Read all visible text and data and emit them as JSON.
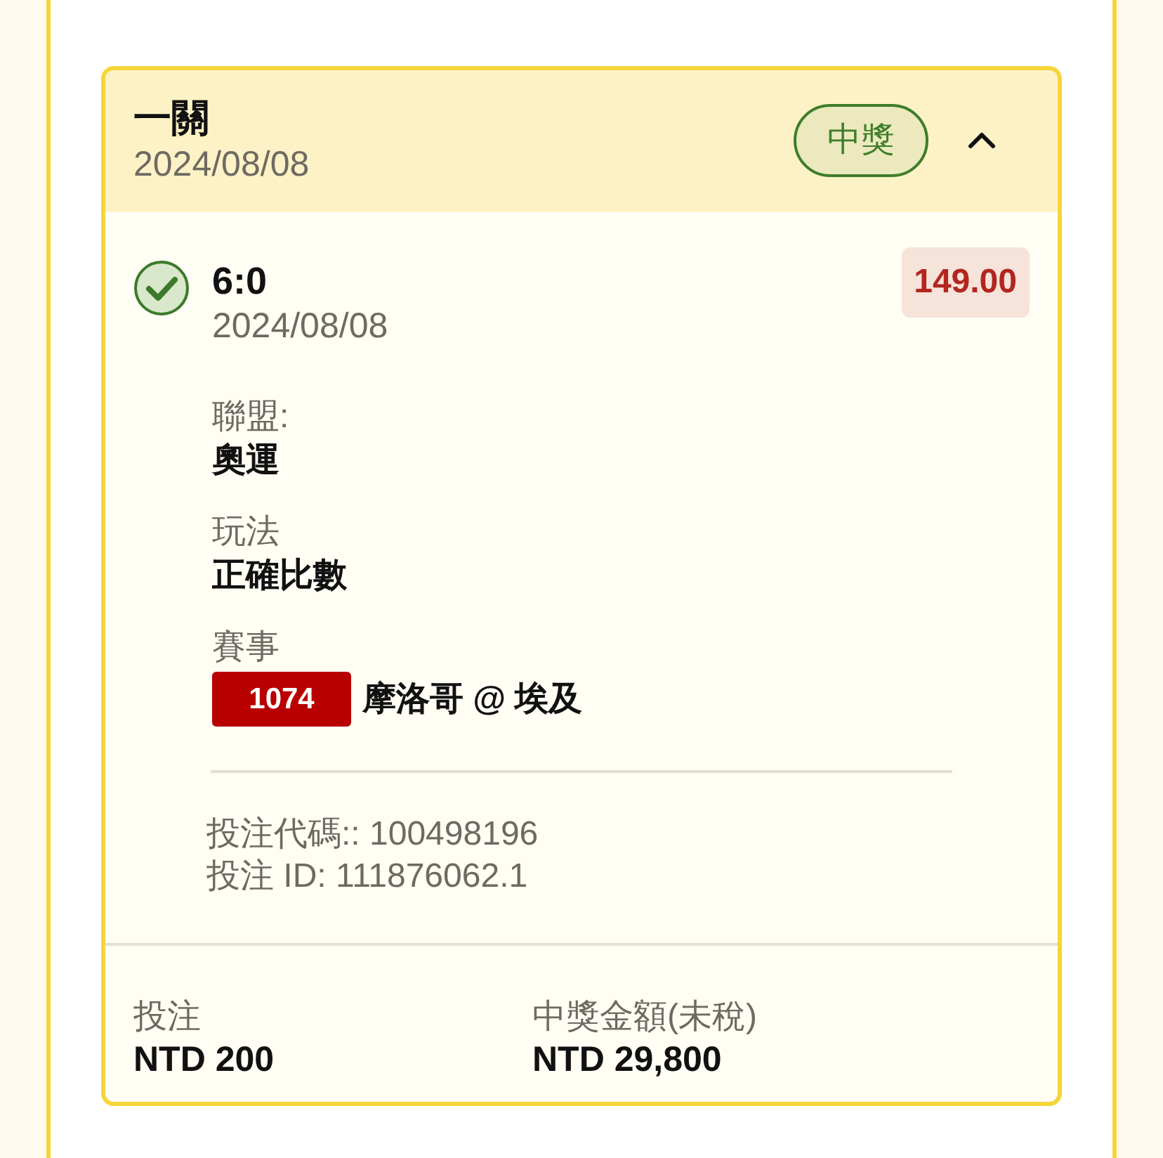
{
  "ticket": {
    "title": "一關",
    "date": "2024/08/08",
    "status": {
      "label": "中獎",
      "kind": "won"
    },
    "expanded": true,
    "selections": [
      {
        "won": true,
        "pick": "6:0",
        "date": "2024/08/08",
        "odds": "149.00",
        "fields": [
          {
            "label": "聯盟:",
            "value": "奧運"
          },
          {
            "label": "玩法",
            "value": "正確比數"
          }
        ],
        "event": {
          "label": "賽事",
          "code": "1074",
          "name": "摩洛哥 @ 埃及"
        }
      }
    ],
    "refs": [
      "投注代碼:: 100498196",
      "投注 ID: 111876062.1"
    ],
    "summary": [
      {
        "label": "投注",
        "value": "NTD 200"
      },
      {
        "label": "中獎金額(未稅)",
        "value": "NTD 29,800"
      }
    ]
  }
}
